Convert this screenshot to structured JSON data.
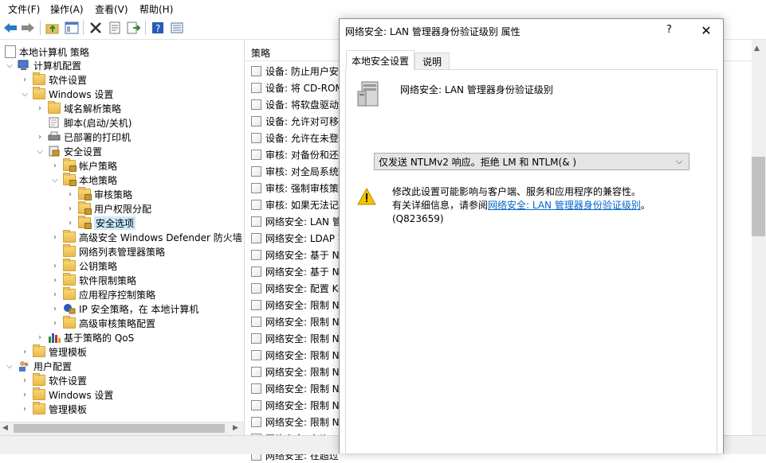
{
  "menu": [
    "文件(F)",
    "操作(A)",
    "查看(V)",
    "帮助(H)"
  ],
  "toolbar": {
    "icons": [
      "back-arrow-icon",
      "forward-arrow-icon",
      "up-folder-icon",
      "show-hide-tree-icon",
      "delete-icon",
      "properties-icon",
      "export-list-icon",
      "help-icon",
      "view-icon"
    ]
  },
  "tree": {
    "root": "本地计算机 策略",
    "computer_config": "计算机配置",
    "software_settings": "软件设置",
    "windows_settings": "Windows 设置",
    "dns_policy": "域名解析策略",
    "scripts": "脚本(启动/关机)",
    "printers": "已部署的打印机",
    "security_settings": "安全设置",
    "account_policies": "帐户策略",
    "local_policies": "本地策略",
    "audit_policy": "审核策略",
    "user_rights": "用户权限分配",
    "security_options": "安全选项",
    "firewall": "高级安全 Windows Defender 防火墙",
    "network_list": "网络列表管理器策略",
    "public_key": "公钥策略",
    "software_restriction": "软件限制策略",
    "app_control": "应用程序控制策略",
    "ipsec": "IP 安全策略，在 本地计算机",
    "advanced_audit": "高级审核策略配置",
    "qos": "基于策略的 QoS",
    "admin_templates": "管理模板",
    "user_config": "用户配置",
    "user_software": "软件设置",
    "user_windows": "Windows 设置",
    "user_admin_templates": "管理模板"
  },
  "list": {
    "header": "策略",
    "rows": [
      "设备: 防止用户安装",
      "设备: 将 CD-ROM",
      "设备: 将软盘驱动",
      "设备: 允许对可移",
      "设备: 允许在未登",
      "审核: 对备份和还",
      "审核: 对全局系统",
      "审核: 强制审核策略",
      "审核: 如果无法记录",
      "网络安全: LAN 管",
      "网络安全: LDAP 客",
      "网络安全: 基于 N",
      "网络安全: 基于 N",
      "网络安全: 配置 Ke",
      "网络安全: 限制 N",
      "网络安全: 限制 N",
      "网络安全: 限制 N",
      "网络安全: 限制 N",
      "网络安全: 限制 N",
      "网络安全: 限制 N",
      "网络安全: 限制 N",
      "网络安全: 限制 N",
      "网络安全: 允许 Lo",
      "网络安全: 在超过"
    ]
  },
  "dialog": {
    "title": "网络安全: LAN 管理器身份验证级别 属性",
    "help": "?",
    "close": "✕",
    "tabs": [
      "本地安全设置",
      "说明"
    ],
    "policy_name": "网络安全: LAN 管理器身份验证级别",
    "selected_value": "仅发送 NTLMv2 响应。拒绝 LM 和 NTLM(& )",
    "warning_line1": "修改此设置可能影响与客户端、服务和应用程序的兼容性。",
    "warning_line2_prefix": "有关详细信息，请参阅",
    "warning_link": "网络安全: LAN 管理器身份验证级别",
    "warning_line2_suffix": "。",
    "warning_line3": "(Q823659)"
  },
  "colors": {
    "link": "#0066cc",
    "warning": "#f5c400",
    "selection": "#cce8ff"
  }
}
